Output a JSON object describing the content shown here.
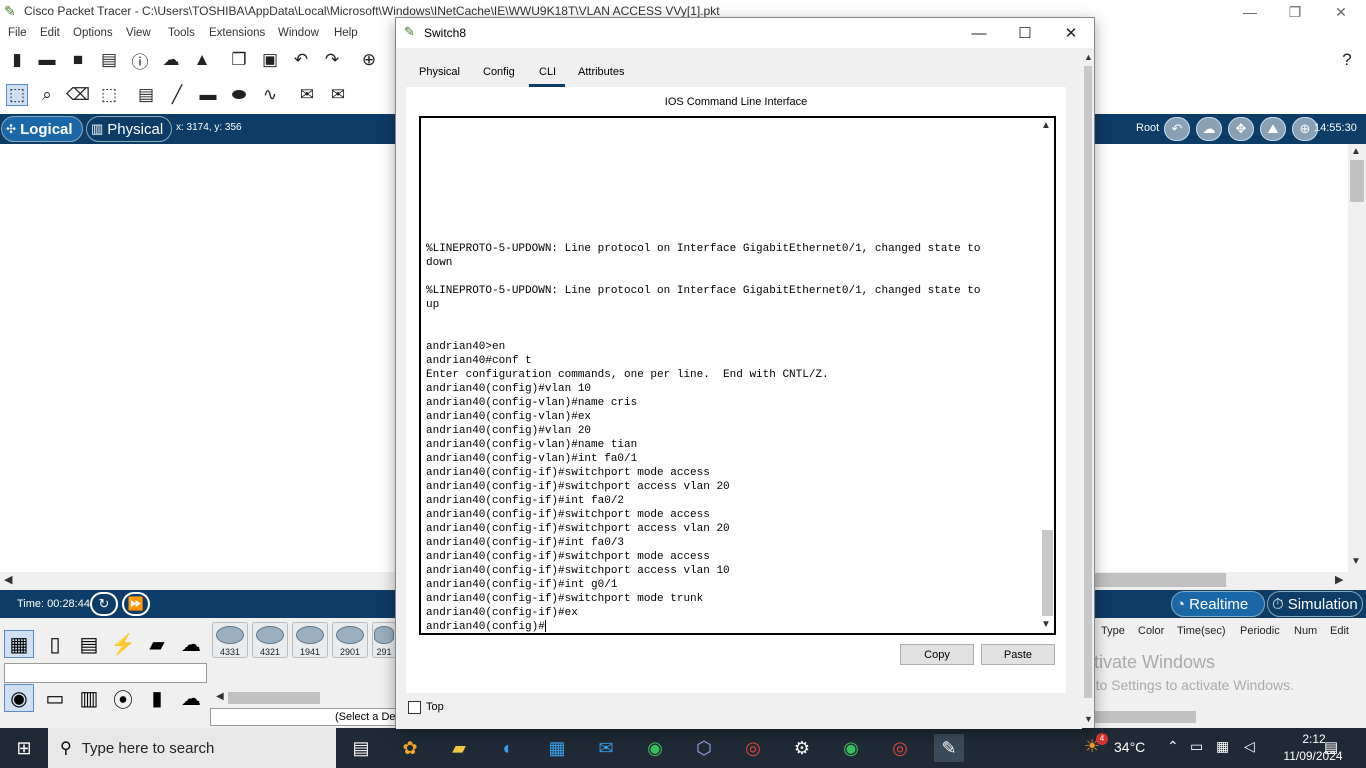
{
  "app": {
    "title": "Cisco Packet Tracer - C:\\Users\\TOSHIBA\\AppData\\Local\\Microsoft\\Windows\\INetCache\\IE\\WWU9K18T\\VLAN ACCESS VVy[1].pkt",
    "menus": [
      "File",
      "Edit",
      "Options",
      "View",
      "Tools",
      "Extensions",
      "Window",
      "Help"
    ],
    "mode_logical": "Logical",
    "mode_physical": "Physical",
    "coords": "x: 3174, y: 356",
    "root_label": "Root",
    "clock": "14:55:30",
    "time_label": "Time: 00:28:44",
    "realtime": "Realtime",
    "simulation": "Simulation",
    "router_models": [
      "4331",
      "4321",
      "1941",
      "2901",
      "291"
    ],
    "select_hint": "(Select a De",
    "pdu_columns": [
      "Type",
      "Color",
      "Time(sec)",
      "Periodic",
      "Num",
      "Edit"
    ],
    "watermark_title": "Activate Windows",
    "watermark_sub": "Go to Settings to activate Windows."
  },
  "dialog": {
    "title": "Switch8",
    "tabs": [
      "Physical",
      "Config",
      "CLI",
      "Attributes"
    ],
    "active_tab": "CLI",
    "cli_heading": "IOS Command Line Interface",
    "terminal_lines": [
      "%LINEPROTO-5-UPDOWN: Line protocol on Interface GigabitEthernet0/1, changed state to",
      "down",
      "",
      "%LINEPROTO-5-UPDOWN: Line protocol on Interface GigabitEthernet0/1, changed state to",
      "up",
      "",
      "",
      "andrian40>en",
      "andrian40#conf t",
      "Enter configuration commands, one per line.  End with CNTL/Z.",
      "andrian40(config)#vlan 10",
      "andrian40(config-vlan)#name cris",
      "andrian40(config-vlan)#ex",
      "andrian40(config)#vlan 20",
      "andrian40(config-vlan)#name tian",
      "andrian40(config-vlan)#int fa0/1",
      "andrian40(config-if)#switchport mode access",
      "andrian40(config-if)#switchport access vlan 20",
      "andrian40(config-if)#int fa0/2",
      "andrian40(config-if)#switchport mode access",
      "andrian40(config-if)#switchport access vlan 20",
      "andrian40(config-if)#int fa0/3",
      "andrian40(config-if)#switchport mode access",
      "andrian40(config-if)#switchport access vlan 10",
      "andrian40(config-if)#int g0/1",
      "andrian40(config-if)#switchport mode trunk",
      "andrian40(config-if)#ex",
      "andrian40(config)#"
    ],
    "copy_label": "Copy",
    "paste_label": "Paste",
    "top_label": "Top"
  },
  "taskbar": {
    "search_placeholder": "Type here to search",
    "temperature": "34°C",
    "weather_badge": "4",
    "time": "2:12",
    "date": "11/09/2024"
  }
}
